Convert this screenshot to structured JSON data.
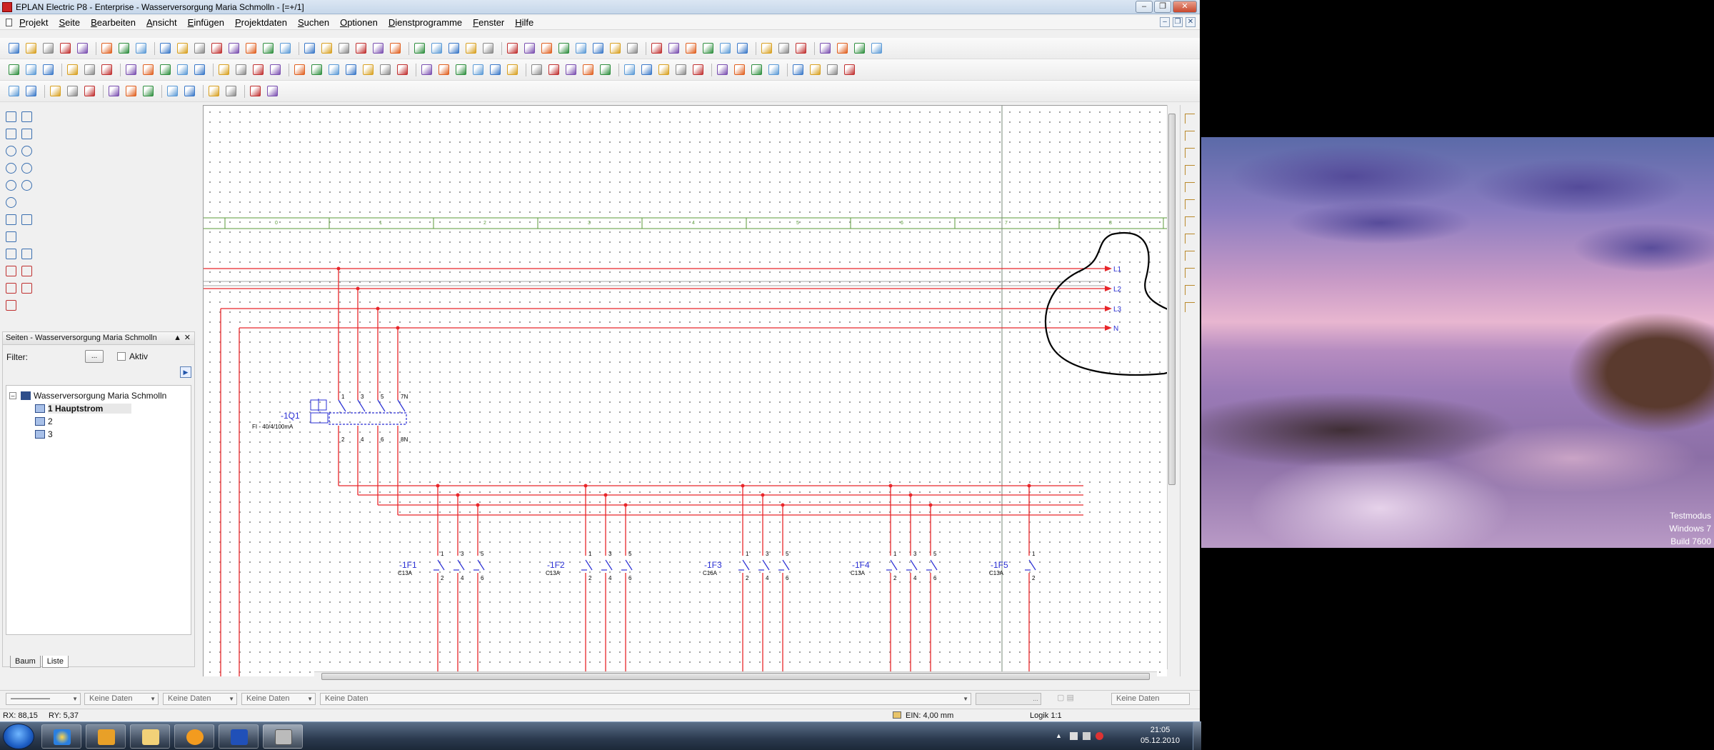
{
  "window": {
    "title": "EPLAN Electric P8 - Enterprise - Wasserversorgung Maria Schmolln - [=+/1]"
  },
  "menu": [
    {
      "pre": "",
      "u": "P",
      "post": "rojekt"
    },
    {
      "pre": "",
      "u": "S",
      "post": "eite"
    },
    {
      "pre": "",
      "u": "B",
      "post": "earbeiten"
    },
    {
      "pre": "",
      "u": "A",
      "post": "nsicht"
    },
    {
      "pre": "",
      "u": "E",
      "post": "infügen"
    },
    {
      "pre": "",
      "u": "P",
      "post": "rojektdaten"
    },
    {
      "pre": "",
      "u": "S",
      "post": "uchen"
    },
    {
      "pre": "",
      "u": "O",
      "post": "ptionen"
    },
    {
      "pre": "",
      "u": "D",
      "post": "ienstprogramme"
    },
    {
      "pre": "",
      "u": "F",
      "post": "enster"
    },
    {
      "pre": "",
      "u": "H",
      "post": "ilfe"
    }
  ],
  "pages_panel": {
    "title": "Seiten - Wasserversorgung Maria Schmolln",
    "filter_label": "Filter:",
    "filter_button": "...",
    "active_label": "Aktiv",
    "tree": {
      "project": "Wasserversorgung Maria Schmolln",
      "pages": [
        "1 Hauptstrom",
        "2",
        "3"
      ]
    },
    "tabs": [
      "Baum",
      "Liste"
    ]
  },
  "schematic": {
    "busbars": [
      "L1",
      "L2",
      "L3",
      "N"
    ],
    "rcd": {
      "tag": "-1Q1",
      "desc": "FI - 40/4/100mA",
      "top_terms": [
        "1",
        "3",
        "5",
        "7N"
      ],
      "bottom_terms": [
        "2",
        "4",
        "6",
        "8N"
      ]
    },
    "breakers": [
      {
        "tag": "-1F1",
        "rating": "C13A",
        "poles": 3
      },
      {
        "tag": "-1F2",
        "rating": "C13A",
        "poles": 3
      },
      {
        "tag": "-1F3",
        "rating": "C16A",
        "poles": 3
      },
      {
        "tag": "-1F4",
        "rating": "C13A",
        "poles": 3
      },
      {
        "tag": "-1F5",
        "rating": "C13A",
        "poles": 1
      }
    ],
    "pole_top_terms": [
      "1",
      "3",
      "5"
    ],
    "pole_bottom_terms": [
      "2",
      "4",
      "6"
    ],
    "column_numbers": [
      "0",
      "1",
      "2",
      "3",
      "4",
      "5",
      "6",
      "7",
      "8",
      "9"
    ],
    "colors": {
      "wire": "#e8262a",
      "symbol": "#2a2fd4",
      "grid_frame": "#5b9a3a",
      "annotation": "#000000"
    }
  },
  "propbar": {
    "fields": [
      "Keine Daten",
      "Keine Daten",
      "Keine Daten",
      "Keine Daten",
      "Keine Daten"
    ]
  },
  "status": {
    "rx": "RX: 88,15",
    "ry": "RY: 5,37",
    "ein": "EIN: 4,00 mm",
    "logik": "Logik 1:1"
  },
  "desktop": {
    "watermark": [
      "Testmodus",
      "Windows 7",
      "Build 7600"
    ]
  },
  "taskbar": {
    "time": "21:05",
    "date": "05.12.2010"
  }
}
